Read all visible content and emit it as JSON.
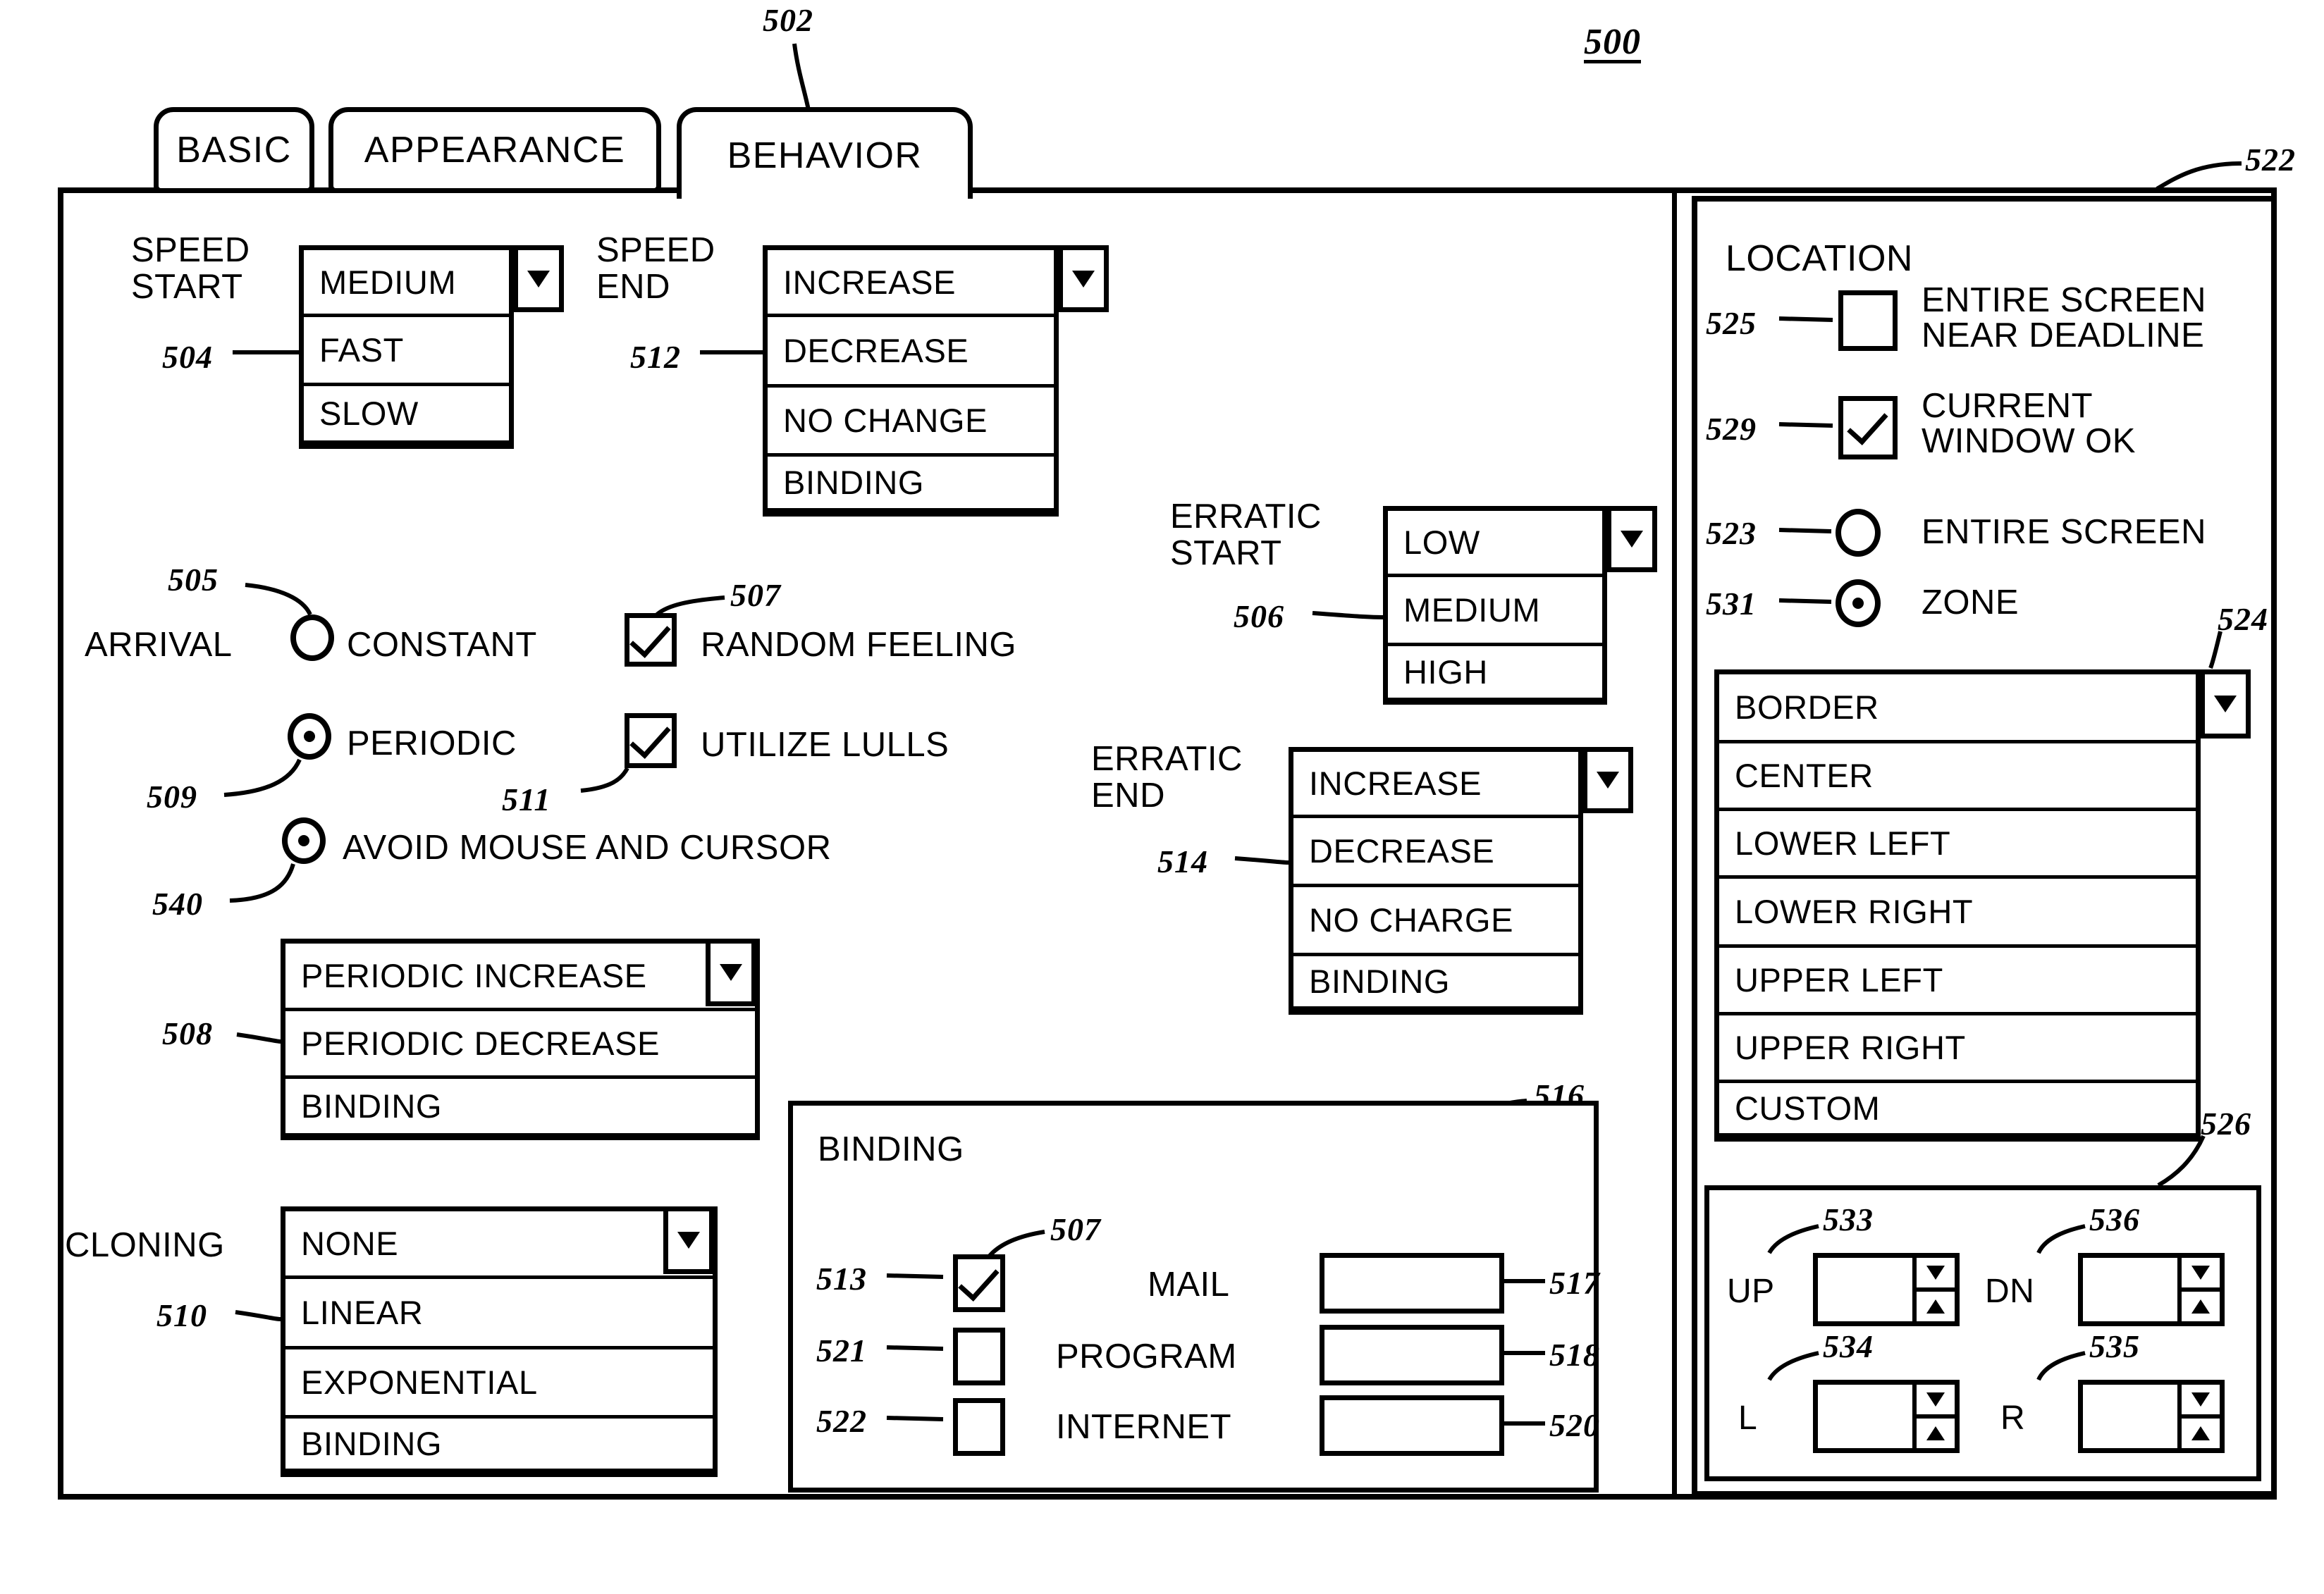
{
  "figure": {
    "number": "500",
    "tab_strip_ref": "502",
    "right_panel_ref": "522",
    "border_list_ref": "524",
    "zone_panel_ref": "526",
    "binding_panel_ref": "516"
  },
  "tabs": [
    {
      "label": "BASIC",
      "active": false
    },
    {
      "label": "APPEARANCE",
      "active": false
    },
    {
      "label": "BEHAVIOR",
      "active": true
    }
  ],
  "left_panel": {
    "speed_start": {
      "label": "SPEED\nSTART",
      "ref": "504",
      "selected": "MEDIUM",
      "options": [
        "MEDIUM",
        "FAST",
        "SLOW"
      ]
    },
    "speed_end": {
      "label": "SPEED\nEND",
      "ref": "512",
      "selected": "INCREASE",
      "options": [
        "INCREASE",
        "DECREASE",
        "NO CHANGE",
        "BINDING"
      ]
    },
    "arrival": {
      "label": "ARRIVAL",
      "options": [
        {
          "label": "CONSTANT",
          "ref": "505",
          "selected": false
        },
        {
          "label": "PERIODIC",
          "ref": "509",
          "selected": true
        }
      ]
    },
    "avoid_mouse": {
      "label": "AVOID MOUSE AND CURSOR",
      "ref": "540",
      "selected": true
    },
    "checkboxes": [
      {
        "label": "RANDOM FEELING",
        "ref": "507",
        "checked": true
      },
      {
        "label": "UTILIZE LULLS",
        "ref": "511",
        "checked": true
      }
    ],
    "periodic": {
      "ref": "508",
      "selected": "PERIODIC INCREASE",
      "options": [
        "PERIODIC INCREASE",
        "PERIODIC DECREASE",
        "BINDING"
      ]
    },
    "cloning": {
      "label": "CLONING",
      "ref": "510",
      "selected": "NONE",
      "options": [
        "NONE",
        "LINEAR",
        "EXPONENTIAL",
        "BINDING"
      ]
    },
    "erratic_start": {
      "label": "ERRATIC\nSTART",
      "ref": "506",
      "selected": "LOW",
      "options": [
        "LOW",
        "MEDIUM",
        "HIGH"
      ]
    },
    "erratic_end": {
      "label": "ERRATIC\nEND",
      "ref": "514",
      "selected": "INCREASE",
      "options": [
        "INCREASE",
        "DECREASE",
        "NO CHARGE",
        "BINDING"
      ]
    },
    "binding_panel": {
      "title": "BINDING",
      "ref": "516",
      "rows": [
        {
          "label": "MAIL",
          "checked": true,
          "checkbox_ref": "513",
          "check_ref": "507",
          "field_value": "",
          "field_ref": "517"
        },
        {
          "label": "PROGRAM",
          "checked": false,
          "checkbox_ref": "521",
          "check_ref": "",
          "field_value": "",
          "field_ref": "518"
        },
        {
          "label": "INTERNET",
          "checked": false,
          "checkbox_ref": "522",
          "check_ref": "",
          "field_value": "",
          "field_ref": "520"
        }
      ]
    }
  },
  "right_panel": {
    "title": "LOCATION",
    "ref": "522",
    "options": [
      {
        "label": "ENTIRE SCREEN\nNEAR DEADLINE",
        "type": "checkbox",
        "checked": false,
        "ref": "525"
      },
      {
        "label": "CURRENT\nWINDOW OK",
        "type": "checkbox",
        "checked": true,
        "ref": "529"
      },
      {
        "label": "ENTIRE SCREEN",
        "type": "radio",
        "checked": false,
        "ref": "523"
      },
      {
        "label": "ZONE",
        "type": "radio",
        "checked": true,
        "ref": "531"
      }
    ],
    "location_list": {
      "ref": "524",
      "selected": "BORDER",
      "options": [
        "BORDER",
        "CENTER",
        "LOWER LEFT",
        "LOWER RIGHT",
        "UPPER LEFT",
        "UPPER RIGHT",
        "CUSTOM"
      ]
    },
    "zone_spinners": {
      "ref": "526",
      "items": [
        {
          "label": "UP",
          "ref": "533",
          "value": ""
        },
        {
          "label": "DN",
          "ref": "536",
          "value": ""
        },
        {
          "label": "L",
          "ref": "534",
          "value": ""
        },
        {
          "label": "R",
          "ref": "535",
          "value": ""
        }
      ]
    }
  }
}
